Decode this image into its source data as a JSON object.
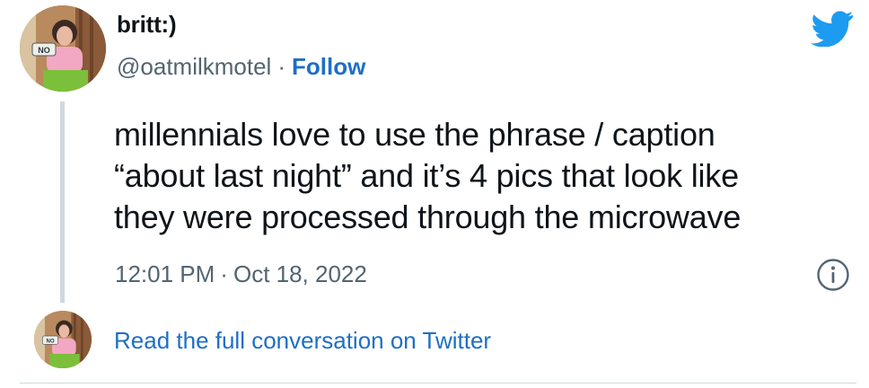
{
  "author": {
    "display_name": "britt:)",
    "handle": "@oatmilkmotel",
    "separator": "·",
    "follow_label": "Follow",
    "avatar_sign_text": "NO"
  },
  "tweet": {
    "lines": [
      "millennials love to use the phrase / caption",
      "“about last night” and it’s 4 pics that look like",
      "they were processed through the microwave"
    ],
    "time": "12:01 PM",
    "separator": "·",
    "date": "Oct 18, 2022"
  },
  "footer": {
    "read_more_label": "Read the full conversation on Twitter"
  },
  "icons": {
    "brand": "twitter-bird-icon",
    "info": "info-icon"
  },
  "colors": {
    "link": "#1d6fc6",
    "brand": "#1d9bf0",
    "secondary_text": "#536471",
    "thread_line": "#cfd9de"
  }
}
